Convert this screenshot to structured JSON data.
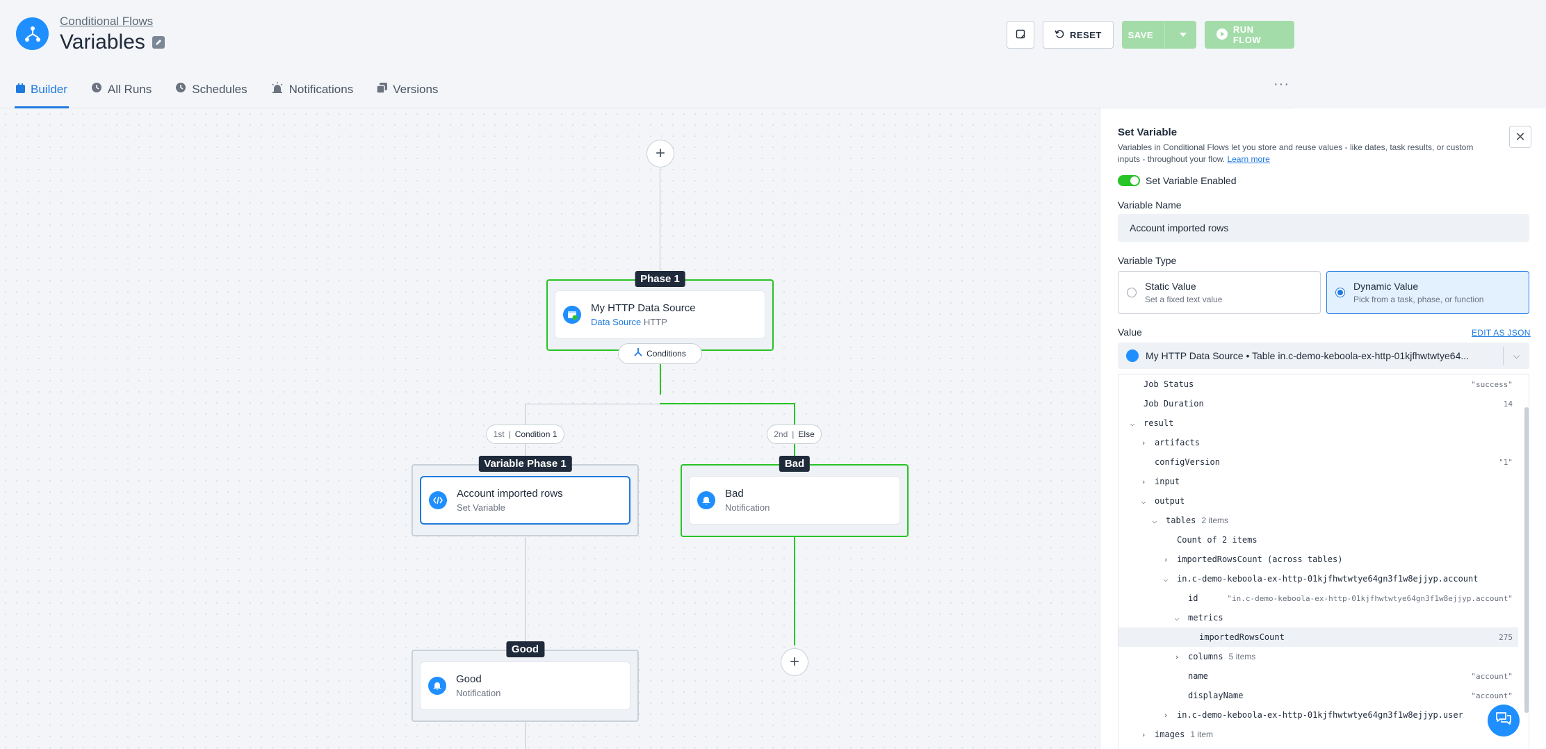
{
  "header": {
    "breadcrumb": "Conditional Flows",
    "title": "Variables"
  },
  "toolbar": {
    "reset_label": "RESET",
    "save_label": "SAVE",
    "run_label": "RUN FLOW"
  },
  "tabs": [
    {
      "label": "Builder",
      "icon": "calendar-icon"
    },
    {
      "label": "All Runs",
      "icon": "clock-icon"
    },
    {
      "label": "Schedules",
      "icon": "clock-icon"
    },
    {
      "label": "Notifications",
      "icon": "alarm-icon"
    },
    {
      "label": "Versions",
      "icon": "copy-icon"
    }
  ],
  "flow": {
    "phase1": {
      "label": "Phase 1",
      "task_title": "My HTTP Data Source",
      "task_sub_link": "Data Source",
      "task_sub_rest": "HTTP"
    },
    "conditions_label": "Conditions",
    "branch1": {
      "order": "1st",
      "label": "Condition 1"
    },
    "branch2": {
      "order": "2nd",
      "label": "Else"
    },
    "variable_phase": {
      "label": "Variable Phase 1",
      "task_title": "Account imported rows",
      "task_sub": "Set Variable"
    },
    "bad_phase": {
      "label": "Bad",
      "task_title": "Bad",
      "task_sub": "Notification"
    },
    "good_phase": {
      "label": "Good",
      "task_title": "Good",
      "task_sub": "Notification"
    }
  },
  "panel": {
    "title": "Set Variable",
    "description": "Variables in Conditional Flows let you store and reuse values - like dates, task results, or custom inputs - throughout your flow.",
    "learn_more": "Learn more",
    "toggle_label": "Set Variable Enabled",
    "name_label": "Variable Name",
    "name_value": "Account imported rows",
    "type_label": "Variable Type",
    "static_title": "Static Value",
    "static_sub": "Set a fixed text value",
    "dynamic_title": "Dynamic Value",
    "dynamic_sub": "Pick from a task, phase, or function",
    "value_label": "Value",
    "edit_json": "EDIT AS JSON",
    "select_value": "My HTTP Data Source • Table in.c-demo-keboola-ex-http-01kjfhwtwtye64...",
    "tree": [
      {
        "key": "Job Status",
        "value": "\"success\""
      },
      {
        "key": "Job Duration",
        "value": "14"
      },
      {
        "key": "result"
      },
      {
        "key": "artifacts"
      },
      {
        "key": "configVersion",
        "value": "\"1\""
      },
      {
        "key": "input"
      },
      {
        "key": "output"
      },
      {
        "key": "tables",
        "count": "2 items"
      },
      {
        "key": "Count of 2 items"
      },
      {
        "key": "importedRowsCount (across tables)"
      },
      {
        "key": "in.c-demo-keboola-ex-http-01kjfhwtwtye64gn3f1w8ejjyp.account"
      },
      {
        "key": "id",
        "value": "\"in.c-demo-keboola-ex-http-01kjfhwtwtye64gn3f1w8ejjyp.account\""
      },
      {
        "key": "metrics"
      },
      {
        "key": "importedRowsCount",
        "value": "275"
      },
      {
        "key": "columns",
        "count": "5 items"
      },
      {
        "key": "name",
        "value": "\"account\""
      },
      {
        "key": "displayName",
        "value": "\"account\""
      },
      {
        "key": "in.c-demo-keboola-ex-http-01kjfhwtwtye64gn3f1w8ejjyp.user"
      },
      {
        "key": "images",
        "count": "1 item"
      }
    ]
  },
  "colors": {
    "accent": "#1f7ae0",
    "success": "#27c427",
    "disabled_green": "#a3dca9"
  }
}
